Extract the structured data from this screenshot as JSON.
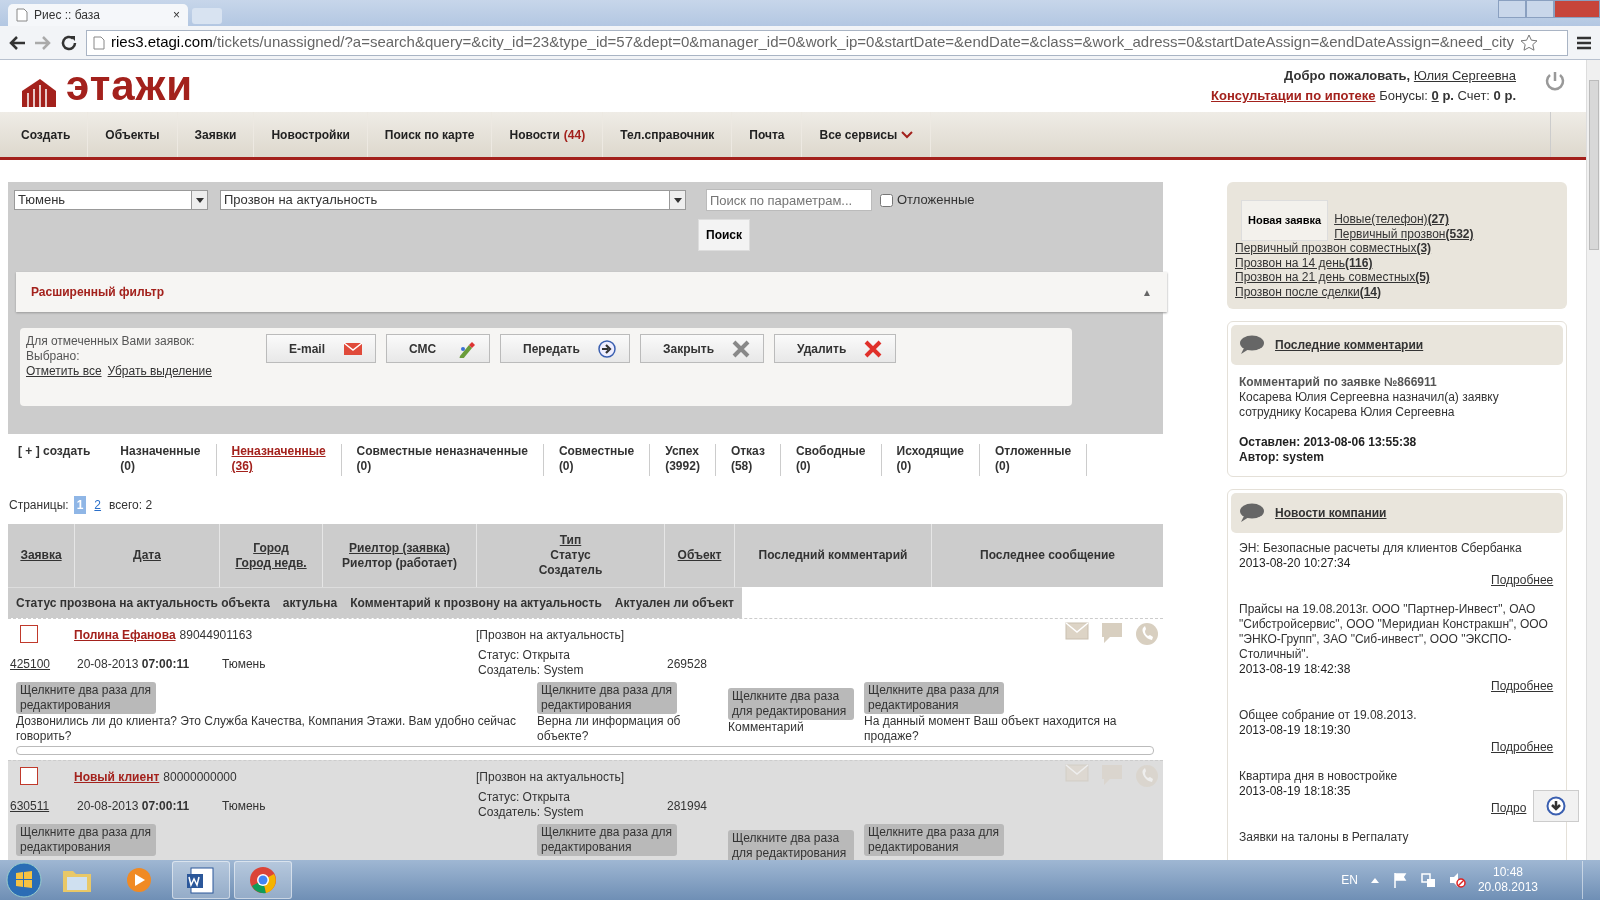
{
  "browser": {
    "tab_title": "Риес :: база",
    "tab_close": "×",
    "url": "ries3.etagi.com/tickets/unassigned/?a=search&query=&city_id=23&type_id=57&dept=0&manager_id=0&work_ip=0&startDate=&endDate=&class=&work_adress=0&startDateAssign=&endDateAssign=&need_city"
  },
  "header": {
    "logo": "этажи",
    "welcome": "Добро пожаловать,",
    "user": "Юлия Сергеевна",
    "mortgage_link": "Консультации по ипотеке",
    "bonus_label": "Бонусы:",
    "bonus": "0",
    "bonus_unit": "р.",
    "account_label": "Счет:",
    "account": "0 р."
  },
  "nav": [
    {
      "label": "Создать"
    },
    {
      "label": "Объекты"
    },
    {
      "label": "Заявки"
    },
    {
      "label": "Новостройки"
    },
    {
      "label": "Поиск по карте"
    },
    {
      "label": "Новости",
      "badge": "(44)"
    },
    {
      "label": "Тел.справочник"
    },
    {
      "label": "Почта"
    },
    {
      "label": "Все сервисы",
      "dropdown": true
    }
  ],
  "filters": {
    "city": "Тюмень",
    "type": "Прозвон на актуальность",
    "search_placeholder": "Поиск по параметрам...",
    "postponed": {
      "label": "Отложенные",
      "checked": false
    },
    "search_button": "Поиск"
  },
  "advanced_filter": {
    "title": "Расширенный фильтр",
    "toggle": "▲"
  },
  "actions": {
    "caption": "Для отмеченных Вами заявок:",
    "selected_label": "Выбрано:",
    "select_all": "Отметить все",
    "deselect": "Убрать выделение",
    "buttons": [
      {
        "label": "E-mail",
        "kind": "mail"
      },
      {
        "label": "СМС",
        "kind": "sms"
      },
      {
        "label": "Передать",
        "kind": "forward"
      },
      {
        "label": "Закрыть",
        "kind": "close"
      },
      {
        "label": "Удалить",
        "kind": "delete"
      }
    ]
  },
  "create_link": "[ + ] создать",
  "tabs": [
    {
      "label": "Назначенные",
      "count": "(0)",
      "selected": false
    },
    {
      "label": "Неназначенные",
      "count": "(36)",
      "selected": true
    },
    {
      "label": "Совместные неназначенные",
      "count": "(0)",
      "selected": false
    },
    {
      "label": "Совместные",
      "count": "(0)",
      "selected": false
    },
    {
      "label": "Успех",
      "count": "(3992)",
      "selected": false
    },
    {
      "label": "Отказ",
      "count": "(58)",
      "selected": false
    },
    {
      "label": "Свободные",
      "count": "(0)",
      "selected": false
    },
    {
      "label": "Исходящие",
      "count": "(0)",
      "selected": false
    },
    {
      "label": "Отложенные",
      "count": "(0)",
      "selected": false
    }
  ],
  "pagination": {
    "label": "Страницы:",
    "pages": [
      {
        "label": "1",
        "selected": true
      },
      {
        "label": "2",
        "selected": false
      }
    ],
    "total": "всего: 2"
  },
  "table": {
    "columns": [
      [
        {
          "text": "Заявка",
          "link": true
        }
      ],
      [
        {
          "text": "Дата",
          "link": true
        }
      ],
      [
        {
          "text": "Город",
          "link": true
        },
        {
          "text": "Город недв.",
          "link": true
        }
      ],
      [
        {
          "text": "Риелтор (заявка)",
          "link": true
        },
        {
          "text": "Риелтор (работает)",
          "link": false
        }
      ],
      [
        {
          "text": "Тип",
          "link": true
        },
        {
          "text": "Статус",
          "link": false
        },
        {
          "text": "Создатель",
          "link": false
        }
      ],
      [
        {
          "text": "Объект",
          "link": true
        }
      ],
      [
        {
          "text": "Последний комментарий",
          "link": false
        }
      ],
      [
        {
          "text": "Последнее сообщение",
          "link": false
        }
      ]
    ],
    "subheader": [
      "Статус прозвона на актуальность объекта",
      "актульна",
      "Комментарий к прозвону на актуальность",
      "Актуален ли объект"
    ],
    "rows": [
      {
        "checked": false,
        "highlighted": false,
        "client": "Полина Ефанова",
        "phone": "89044901163",
        "id": "425100",
        "date": "20-08-2013",
        "time": "07:00:11",
        "city": "Тюмень",
        "type": "[Прозвон на актуальность]",
        "status": "Статус: Открыта",
        "creator": "Создатель: System",
        "object": "269528",
        "fields": [
          {
            "hint": "Щелкните два раза для редактирования",
            "text": "Дозвонились ли до клиента? Это Служба Качества, Компания Этажи. Вам удобно сейчас говорить?"
          },
          {
            "hint": "Щелкните два раза для редактирования",
            "text": "Верна ли информация об объекте?"
          },
          {
            "hint": "Щелкните два раза для редактирования",
            "text": "Комментарий"
          },
          {
            "hint": "Щелкните два раза для редактирования",
            "text": "На данный момент Ваш объект находится на продаже?"
          }
        ]
      },
      {
        "checked": false,
        "highlighted": true,
        "client": "Новый клиент",
        "phone": "80000000000",
        "id": "630511",
        "date": "20-08-2013",
        "time": "07:00:11",
        "city": "Тюмень",
        "type": "[Прозвон на актуальность]",
        "status": "Статус: Открыта",
        "creator": "Создатель: System",
        "object": "281994",
        "fields": [
          {
            "hint": "Щелкните два раза для редактирования"
          },
          {
            "hint": "Щелкните два раза для редактирования"
          },
          {
            "hint": "Щелкните два раза для редактирования"
          },
          {
            "hint": "Щелкните два раза для редактирования"
          }
        ]
      }
    ]
  },
  "sidebar": {
    "new_request": "Новая заявка",
    "links": [
      {
        "label": "Новые(телефон)",
        "count": "(27)"
      },
      {
        "label": "Первичный прозвон",
        "count": "(532)"
      },
      {
        "label": "Первичный прозвон совместных",
        "count": "(3)"
      },
      {
        "label": "Прозвон на 14 день",
        "count": "(116)"
      },
      {
        "label": "Прозвон на 21 день совместных",
        "count": "(5)"
      },
      {
        "label": "Прозвон после сделки",
        "count": "(14)"
      }
    ],
    "comments": {
      "title": "Последние комментарии",
      "heading": "Комментарий по заявке №866911",
      "text": "Косарева Юлия Сергеевна назначил(а) заявку сотруднику Косарева Юлия Сергеевна",
      "left": "Оставлен: 2013-08-06 13:55:38",
      "author": "Автор: system"
    },
    "news": {
      "title": "Новости компании",
      "items": [
        {
          "text": "ЭН: Безопасные расчеты для клиентов Сбербанка",
          "date": "2013-08-20 10:27:34",
          "more": "Подробнее"
        },
        {
          "text": "Прайсы на 19.08.2013г. ООО \"Партнер-Инвест\", ОАО \"Сибстройсервис\", ООО \"Меридиан Констракшн\", ООО \"ЭНКО-Групп\", ЗАО \"Сиб-инвест\", ООО \"ЭКСПО-Столичный\".",
          "date": "2013-08-19 18:42:38",
          "more": "Подробнее"
        },
        {
          "text": "Общее собрание от 19.08.2013.",
          "date": "2013-08-19 18:19:30",
          "more": "Подробнее"
        },
        {
          "text": "Квартира дня в новостройке",
          "date": "2013-08-19 18:18:35",
          "more": "Подро"
        },
        {
          "text": "Заявки на талоны в Регпалату"
        }
      ]
    }
  },
  "taskbar": {
    "language": "EN",
    "time": "10:48",
    "date": "20.08.2013"
  }
}
